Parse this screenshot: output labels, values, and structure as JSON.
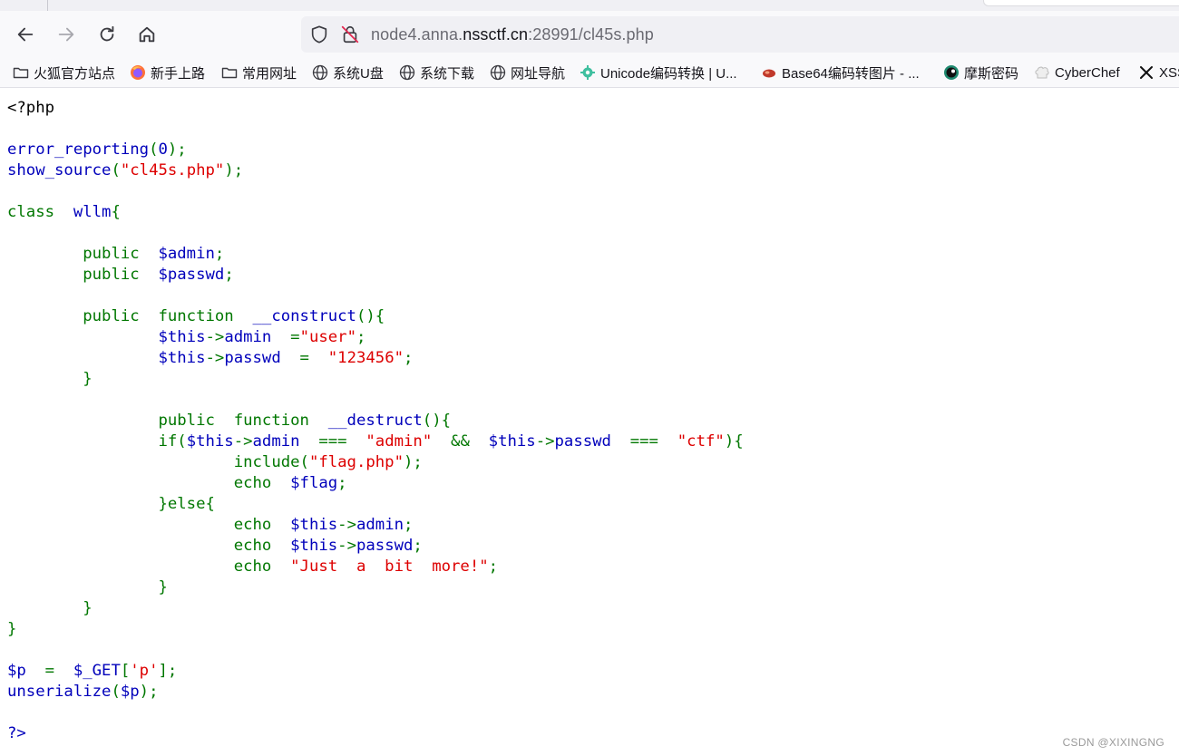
{
  "browser": {
    "url_domain_prefix": "node4.anna.",
    "url_domain": "nssctf.cn",
    "url_path": ":28991/cl45s.php",
    "icons": {
      "back": "arrow-left-icon",
      "forward": "arrow-right-icon",
      "reload": "reload-icon",
      "home": "home-icon",
      "tracking": "shield-icon",
      "insecure": "insecure-lock-icon"
    }
  },
  "bookmarks": [
    {
      "label": "火狐官方站点",
      "icon": "folder-icon"
    },
    {
      "label": "新手上路",
      "icon": "firefox-icon"
    },
    {
      "label": "常用网址",
      "icon": "folder-icon"
    },
    {
      "label": "系统U盘",
      "icon": "globe-icon"
    },
    {
      "label": "系统下载",
      "icon": "globe-icon"
    },
    {
      "label": "网址导航",
      "icon": "globe-icon"
    },
    {
      "label": "Unicode编码转换 | U...",
      "icon": "gear-icon"
    },
    {
      "label": "Base64编码转图片 - ...",
      "icon": "bug-icon"
    },
    {
      "label": "摩斯密码",
      "icon": "circle-logo-icon"
    },
    {
      "label": "CyberChef",
      "icon": "chef-hat-icon"
    },
    {
      "label": "XSS",
      "icon": "x-icon"
    }
  ],
  "code_lines": [
    [
      {
        "c": "html",
        "t": "<?php"
      }
    ],
    [],
    [
      {
        "c": "default",
        "t": "error_reporting"
      },
      {
        "c": "keyword",
        "t": "("
      },
      {
        "c": "default",
        "t": "0"
      },
      {
        "c": "keyword",
        "t": ");"
      }
    ],
    [
      {
        "c": "default",
        "t": "show_source"
      },
      {
        "c": "keyword",
        "t": "("
      },
      {
        "c": "string",
        "t": "\"cl45s.php\""
      },
      {
        "c": "keyword",
        "t": ");"
      }
    ],
    [],
    [
      {
        "c": "keyword",
        "t": "class  "
      },
      {
        "c": "default",
        "t": "wllm"
      },
      {
        "c": "keyword",
        "t": "{"
      }
    ],
    [],
    [
      {
        "c": "keyword",
        "t": "        public  "
      },
      {
        "c": "default",
        "t": "$admin"
      },
      {
        "c": "keyword",
        "t": ";"
      }
    ],
    [
      {
        "c": "keyword",
        "t": "        public  "
      },
      {
        "c": "default",
        "t": "$passwd"
      },
      {
        "c": "keyword",
        "t": ";"
      }
    ],
    [],
    [
      {
        "c": "keyword",
        "t": "        public  function  "
      },
      {
        "c": "default",
        "t": "__construct"
      },
      {
        "c": "keyword",
        "t": "(){"
      }
    ],
    [
      {
        "c": "keyword",
        "t": "                "
      },
      {
        "c": "default",
        "t": "$this"
      },
      {
        "c": "keyword",
        "t": "->"
      },
      {
        "c": "default",
        "t": "admin  "
      },
      {
        "c": "keyword",
        "t": "="
      },
      {
        "c": "string",
        "t": "\"user\""
      },
      {
        "c": "keyword",
        "t": ";"
      }
    ],
    [
      {
        "c": "keyword",
        "t": "                "
      },
      {
        "c": "default",
        "t": "$this"
      },
      {
        "c": "keyword",
        "t": "->"
      },
      {
        "c": "default",
        "t": "passwd  "
      },
      {
        "c": "keyword",
        "t": "=  "
      },
      {
        "c": "string",
        "t": "\"123456\""
      },
      {
        "c": "keyword",
        "t": ";"
      }
    ],
    [
      {
        "c": "keyword",
        "t": "        }"
      }
    ],
    [],
    [
      {
        "c": "keyword",
        "t": "                public  function  "
      },
      {
        "c": "default",
        "t": "__destruct"
      },
      {
        "c": "keyword",
        "t": "(){"
      }
    ],
    [
      {
        "c": "keyword",
        "t": "                if("
      },
      {
        "c": "default",
        "t": "$this"
      },
      {
        "c": "keyword",
        "t": "->"
      },
      {
        "c": "default",
        "t": "admin  "
      },
      {
        "c": "keyword",
        "t": "===  "
      },
      {
        "c": "string",
        "t": "\"admin\"  "
      },
      {
        "c": "keyword",
        "t": "&&  "
      },
      {
        "c": "default",
        "t": "$this"
      },
      {
        "c": "keyword",
        "t": "->"
      },
      {
        "c": "default",
        "t": "passwd  "
      },
      {
        "c": "keyword",
        "t": "===  "
      },
      {
        "c": "string",
        "t": "\"ctf\""
      },
      {
        "c": "keyword",
        "t": "){"
      }
    ],
    [
      {
        "c": "keyword",
        "t": "                        include("
      },
      {
        "c": "string",
        "t": "\"flag.php\""
      },
      {
        "c": "keyword",
        "t": ");"
      }
    ],
    [
      {
        "c": "keyword",
        "t": "                        echo  "
      },
      {
        "c": "default",
        "t": "$flag"
      },
      {
        "c": "keyword",
        "t": ";"
      }
    ],
    [
      {
        "c": "keyword",
        "t": "                }else{"
      }
    ],
    [
      {
        "c": "keyword",
        "t": "                        echo  "
      },
      {
        "c": "default",
        "t": "$this"
      },
      {
        "c": "keyword",
        "t": "->"
      },
      {
        "c": "default",
        "t": "admin"
      },
      {
        "c": "keyword",
        "t": ";"
      }
    ],
    [
      {
        "c": "keyword",
        "t": "                        echo  "
      },
      {
        "c": "default",
        "t": "$this"
      },
      {
        "c": "keyword",
        "t": "->"
      },
      {
        "c": "default",
        "t": "passwd"
      },
      {
        "c": "keyword",
        "t": ";"
      }
    ],
    [
      {
        "c": "keyword",
        "t": "                        echo  "
      },
      {
        "c": "string",
        "t": "\"Just  a  bit  more!\""
      },
      {
        "c": "keyword",
        "t": ";"
      }
    ],
    [
      {
        "c": "keyword",
        "t": "                }"
      }
    ],
    [
      {
        "c": "keyword",
        "t": "        }"
      }
    ],
    [
      {
        "c": "keyword",
        "t": "}"
      }
    ],
    [],
    [
      {
        "c": "default",
        "t": "$p  "
      },
      {
        "c": "keyword",
        "t": "=  "
      },
      {
        "c": "default",
        "t": "$_GET"
      },
      {
        "c": "keyword",
        "t": "["
      },
      {
        "c": "string",
        "t": "'p'"
      },
      {
        "c": "keyword",
        "t": "];"
      }
    ],
    [
      {
        "c": "default",
        "t": "unserialize"
      },
      {
        "c": "keyword",
        "t": "("
      },
      {
        "c": "default",
        "t": "$p"
      },
      {
        "c": "keyword",
        "t": ");"
      }
    ],
    [],
    [
      {
        "c": "default",
        "t": "?>"
      }
    ]
  ],
  "colors": {
    "php_default": "#0000bb",
    "php_keyword": "#007700",
    "php_string": "#dd0000",
    "php_html": "#000000"
  },
  "watermark": "CSDN @XIXINGNG"
}
